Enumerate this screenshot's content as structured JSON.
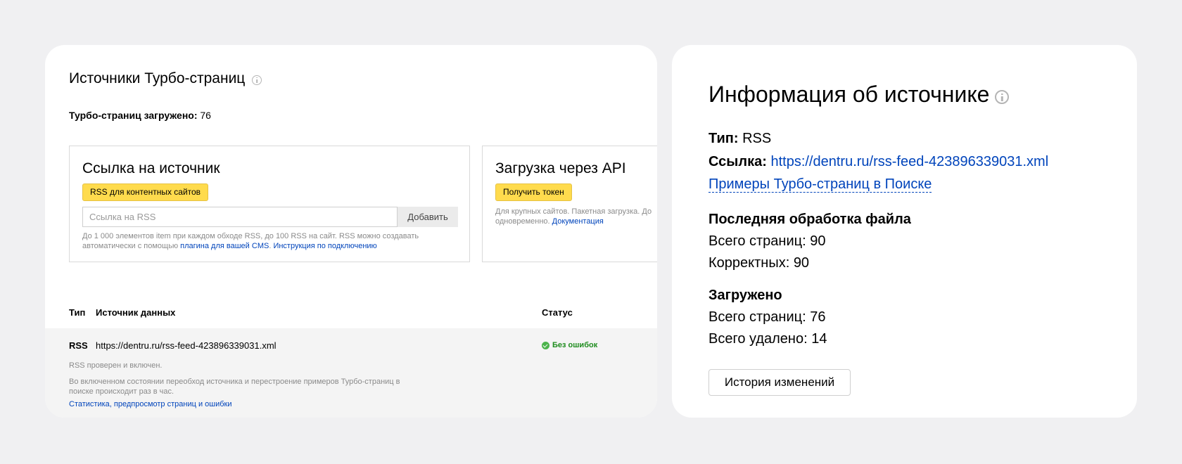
{
  "left": {
    "title": "Источники Турбо-страниц",
    "info_icon": "info-icon",
    "loaded_label": "Турбо-страниц загружено:",
    "loaded_value": "76",
    "link_box": {
      "title": "Ссылка на источник",
      "rss_button": "RSS для контентных сайтов",
      "input_placeholder": "Ссылка на RSS",
      "add_button": "Добавить",
      "hint_text": "До 1 000 элементов item при каждом обходе RSS, до 100 RSS на сайт. RSS можно создавать автоматически с помощью ",
      "hint_link1": "плагина для вашей CMS",
      "hint_sep": ". ",
      "hint_link2": "Инструкция по подключению"
    },
    "api_box": {
      "title": "Загрузка через API",
      "token_button": "Получить токен",
      "hint_line1": "Для крупных сайтов. Пакетная загрузка. До",
      "hint_line2": "одновременно. ",
      "hint_link": "Документация"
    },
    "table": {
      "col_type": "Тип",
      "col_source": "Источник данных",
      "col_status": "Статус",
      "row": {
        "type": "RSS",
        "url": "https://dentru.ru/rss-feed-423896339031.xml",
        "status": "Без ошибок",
        "status_icon": "check-circle-icon",
        "status_color": "#1e8c1e",
        "note1": "RSS проверен и включен.",
        "note2": "Во включенном состоянии переобход источника и перестроение примеров Турбо-страниц в поиске происходит раз в час.",
        "stats_link": "Статистика, предпросмотр страниц и ошибки"
      }
    }
  },
  "right": {
    "title": "Информация об источнике",
    "info_icon": "info-icon",
    "type_label": "Тип:",
    "type_value": "RSS",
    "link_label": "Ссылка:",
    "link_value": "https://dentru.ru/rss-feed-423896339031.xml",
    "examples_link": "Примеры Турбо-страниц в Поиске",
    "last_processing_title": "Последняя обработка файла",
    "total_pages_label": "Всего страниц: ",
    "total_pages_value": "90",
    "correct_label": "Корректных: ",
    "correct_value": "90",
    "loaded_title": "Загружено",
    "loaded_pages_label": "Всего страниц: ",
    "loaded_pages_value": "76",
    "deleted_label": "Всего удалено: ",
    "deleted_value": "14",
    "history_button": "История изменений"
  },
  "colors": {
    "accent_yellow": "#ffdb4d",
    "link_blue": "#0044bb",
    "background": "#f0f0f2"
  }
}
